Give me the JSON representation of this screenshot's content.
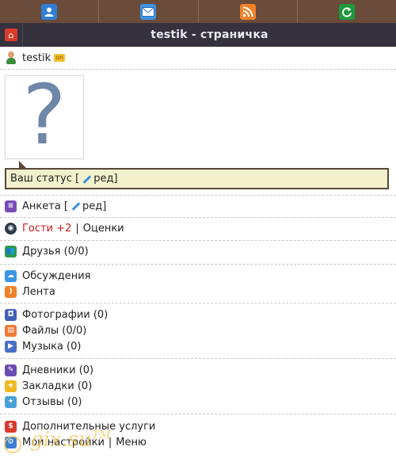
{
  "topbar": {
    "buttons": [
      {
        "name": "profile-button",
        "icon": "user-icon",
        "color": "#2f7fd6"
      },
      {
        "name": "mail-button",
        "icon": "envelope-icon",
        "color": "#3d95e2"
      },
      {
        "name": "feed-button",
        "icon": "rss-icon",
        "color": "#f2822a"
      },
      {
        "name": "refresh-button",
        "icon": "refresh-icon",
        "color": "#1c9a3c"
      }
    ]
  },
  "header": {
    "title": "testik - страничка",
    "home_icon": "home-icon"
  },
  "user": {
    "name": "testik",
    "online_badge": "on"
  },
  "profile": {
    "avatar_glyph": "?",
    "status_prefix": "Ваш статус [",
    "status_edit": "ред",
    "status_suffix": "]"
  },
  "menu": {
    "anketa": {
      "label": "Анкета [",
      "edit": "ред",
      "suffix": "]"
    },
    "guests": {
      "label": "Гости +2",
      "sep": "|",
      "ratings": "Оценки"
    },
    "friends": {
      "label": "Друзья (0/0)"
    },
    "discussions": {
      "label": "Обсуждения"
    },
    "feed": {
      "label": "Лента"
    },
    "photos": {
      "label": "Фотографии (0)"
    },
    "files": {
      "label": "Файлы (0/0)"
    },
    "music": {
      "label": "Музыка (0)"
    },
    "diaries": {
      "label": "Дневники (0)"
    },
    "bookmarks": {
      "label": "Закладки (0)"
    },
    "reviews": {
      "label": "Отзывы (0)"
    },
    "extra": {
      "label": "Дополнительные услуги"
    },
    "settings": {
      "label": "Мои настройки",
      "sep": "|",
      "menu": "Меню"
    }
  },
  "watermark": {
    "text": "gix.su",
    "tm": "TM"
  }
}
